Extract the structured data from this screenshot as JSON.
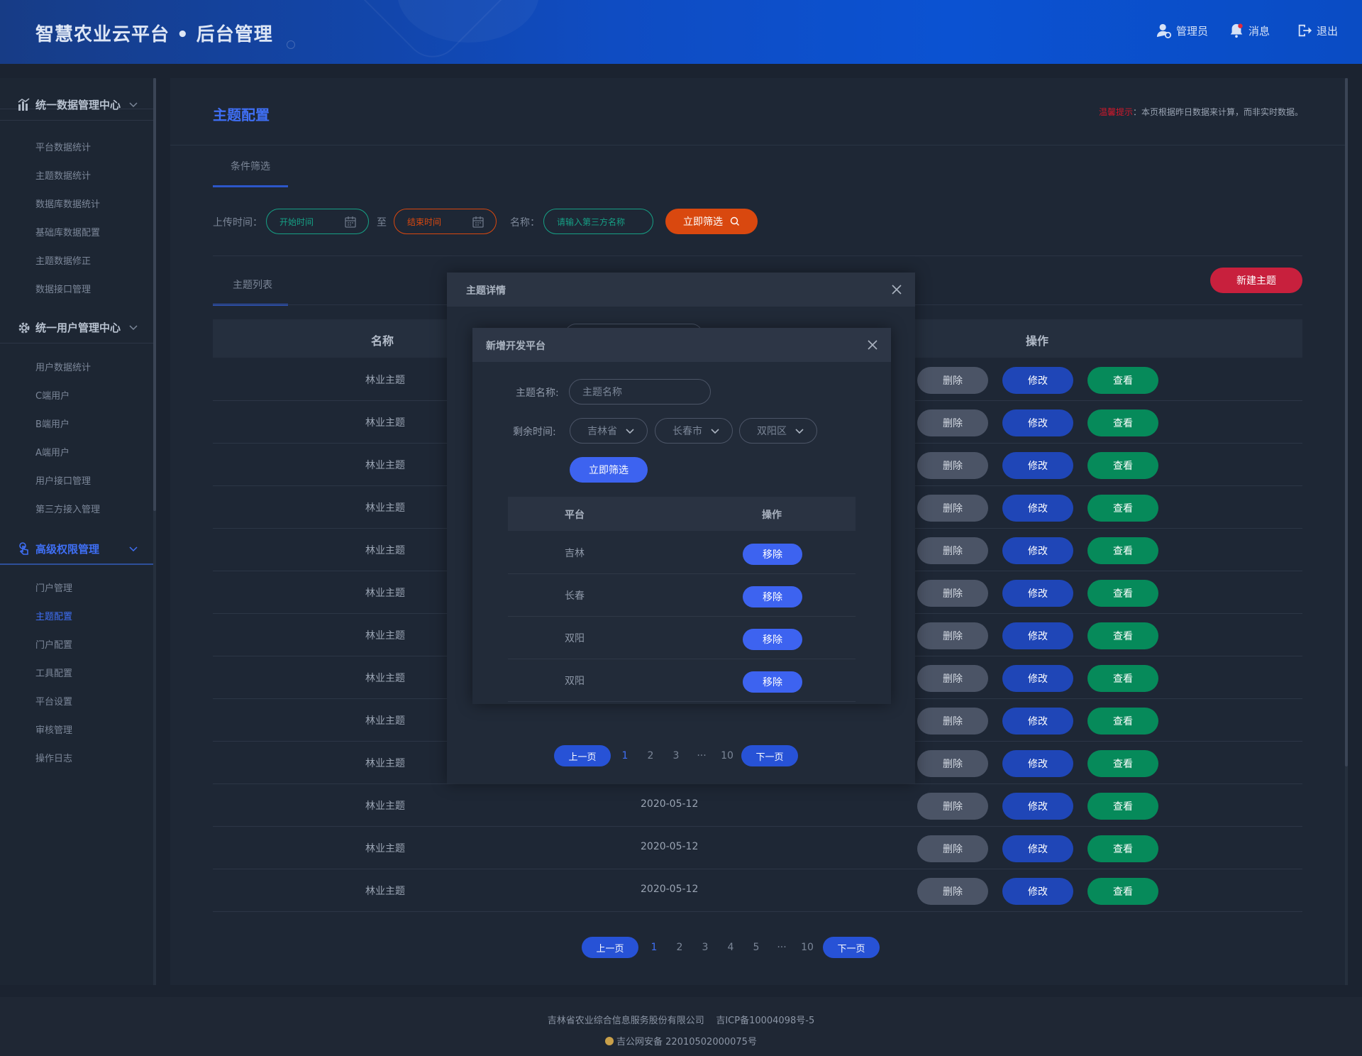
{
  "header": {
    "title": "智慧农业云平台 • 后台管理",
    "admin": "管理员",
    "messages": "消息",
    "logout": "退出"
  },
  "sidebar": {
    "groups": [
      {
        "label": "统一数据管理中心",
        "icon": "bar-chart-icon",
        "items": [
          "平台数据统计",
          "主题数据统计",
          "数据库数据统计",
          "基础库数据配置",
          "主题数据修正",
          "数据接口管理"
        ]
      },
      {
        "label": "统一用户管理中心",
        "icon": "gear-icon",
        "items": [
          "用户数据统计",
          "C端用户",
          "B端用户",
          "A端用户",
          "用户接口管理",
          "第三方接入管理"
        ]
      },
      {
        "label": "高级权限管理",
        "icon": "touch-icon",
        "active": true,
        "items": [
          "门户管理",
          "主题配置",
          "门户配置",
          "工具配置",
          "平台设置",
          "审核管理",
          "操作日志"
        ]
      }
    ],
    "active_item": "主题配置"
  },
  "main": {
    "title": "主题配置",
    "tip_label": "温馨提示",
    "tip_text": "：本页根据昨日数据来计算，而非实时数据。",
    "filter_tab": "条件筛选",
    "filter": {
      "upload_label": "上传时间：",
      "start_placeholder": "开始时间",
      "to": "至",
      "end_placeholder": "结束时间",
      "name_label": "名称：",
      "name_placeholder": "请输入第三方名称",
      "submit": "立即筛选"
    },
    "list_tab": "主题列表",
    "new_button": "新建主题",
    "table": {
      "columns": [
        "名称",
        "操作"
      ],
      "rows": [
        {
          "name": "林业主题",
          "date": ""
        },
        {
          "name": "林业主题",
          "date": ""
        },
        {
          "name": "林业主题",
          "date": ""
        },
        {
          "name": "林业主题",
          "date": ""
        },
        {
          "name": "林业主题",
          "date": ""
        },
        {
          "name": "林业主题",
          "date": ""
        },
        {
          "name": "林业主题",
          "date": ""
        },
        {
          "name": "林业主题",
          "date": ""
        },
        {
          "name": "林业主题",
          "date": ""
        },
        {
          "name": "林业主题",
          "date": ""
        },
        {
          "name": "林业主题",
          "date": "2020-05-12"
        },
        {
          "name": "林业主题",
          "date": "2020-05-12"
        },
        {
          "name": "林业主题",
          "date": "2020-05-12"
        }
      ],
      "actions": {
        "delete": "删除",
        "edit": "修改",
        "view": "查看"
      }
    },
    "pagination": {
      "prev": "上一页",
      "pages": [
        "1",
        "2",
        "3",
        "4",
        "5",
        "···",
        "10"
      ],
      "current": "1",
      "next": "下一页"
    }
  },
  "modal_detail": {
    "title": "主题详情"
  },
  "modal_add": {
    "title": "新增开发平台",
    "name_label": "主题名称:",
    "name_placeholder": "主题名称",
    "time_label": "剩余时间:",
    "province": "吉林省",
    "city": "长春市",
    "district": "双阳区",
    "submit": "立即筛选",
    "columns": [
      "平台",
      "操作"
    ],
    "rows": [
      "吉林",
      "长春",
      "双阳",
      "双阳"
    ],
    "remove": "移除",
    "pagination": {
      "prev": "上一页",
      "pages": [
        "1",
        "2",
        "3",
        "···",
        "10"
      ],
      "current": "1",
      "next": "下一页"
    }
  },
  "footer": {
    "company": "吉林省农业综合信息服务股份有限公司",
    "icp": "吉ICP备10004098号-5",
    "police": "吉公网安备 22010502000075号"
  },
  "colors": {
    "accent": "#3f6ff5",
    "filter": "#d9480f",
    "new": "#c8203d",
    "edit": "#1f46b7",
    "view": "#068a5a",
    "delete": "#4b5466"
  }
}
